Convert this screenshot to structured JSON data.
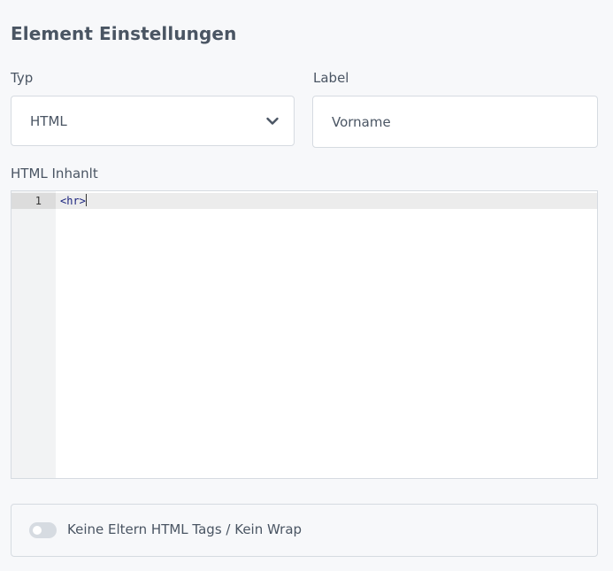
{
  "panel": {
    "title": "Element Einstellungen"
  },
  "type_field": {
    "label": "Typ",
    "selected_value": "HTML"
  },
  "label_field": {
    "label": "Label",
    "value": "Vorname"
  },
  "html_field": {
    "label": "HTML Inhanlt",
    "lines": [
      {
        "number": "1",
        "code": "<hr>"
      }
    ]
  },
  "wrap_option": {
    "label": "Keine Eltern HTML Tags / Kein Wrap",
    "enabled": false
  },
  "icons": {
    "select_chevron": "chevron-down-icon"
  },
  "colors": {
    "text": "#4a5563",
    "border": "#d6dbe1",
    "code_tag": "#1a237e"
  }
}
